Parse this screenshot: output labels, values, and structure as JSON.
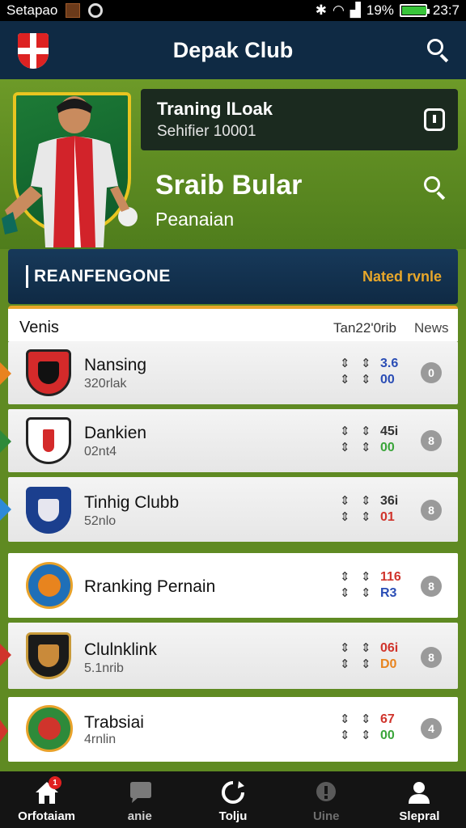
{
  "status_bar": {
    "carrier": "Setapao",
    "battery_pct": "19%",
    "time": "23:7"
  },
  "app_bar": {
    "title": "Depak Club"
  },
  "hero": {
    "card_title": "Traning lLoak",
    "card_subtitle": "Sehifier 10001",
    "player_name": "Sraib Bular",
    "player_sub": "Peanaian"
  },
  "section": {
    "label": "REANFENGONE",
    "link": "Nated rvnle"
  },
  "table": {
    "headers": {
      "col1": "Venis",
      "col2": "Tan22'0rib",
      "col3": "News"
    },
    "rows": [
      {
        "name": "Nansing",
        "sub": "320rlak",
        "v1": "3.6",
        "v2": "00",
        "v1_color": "#2a4db5",
        "v2_color": "#2a4db5",
        "pill": "0"
      },
      {
        "name": "Dankien",
        "sub": "02nt4",
        "v1": "45i",
        "v2": "00",
        "v1_color": "#333333",
        "v2_color": "#3aa53a",
        "pill": "8"
      },
      {
        "name": "Tinhig Clubb",
        "sub": "52nlo",
        "v1": "36i",
        "v2": "01",
        "v1_color": "#333333",
        "v2_color": "#d0342c",
        "pill": "8"
      },
      {
        "name": "Rranking Pernain",
        "sub": "",
        "v1": "116",
        "v2": "R3",
        "v1_color": "#d0342c",
        "v2_color": "#2a4db5",
        "pill": "8"
      },
      {
        "name": "Clulnklink",
        "sub": "5.1nrib",
        "v1": "06i",
        "v2": "D0",
        "v1_color": "#d0342c",
        "v2_color": "#e8841e",
        "pill": "8"
      },
      {
        "name": "Trabsiai",
        "sub": "4rnlin",
        "v1": "67",
        "v2": "00",
        "v1_color": "#d0342c",
        "v2_color": "#3aa53a",
        "pill": "4"
      }
    ]
  },
  "bottom_nav": [
    {
      "label": "Orfotaiam",
      "icon": "home-icon",
      "badge": "1"
    },
    {
      "label": "anie",
      "icon": "chat-icon"
    },
    {
      "label": "Tolju",
      "icon": "refresh-icon"
    },
    {
      "label": "Uine",
      "icon": "info-icon"
    },
    {
      "label": "Slepral",
      "icon": "profile-icon"
    }
  ]
}
